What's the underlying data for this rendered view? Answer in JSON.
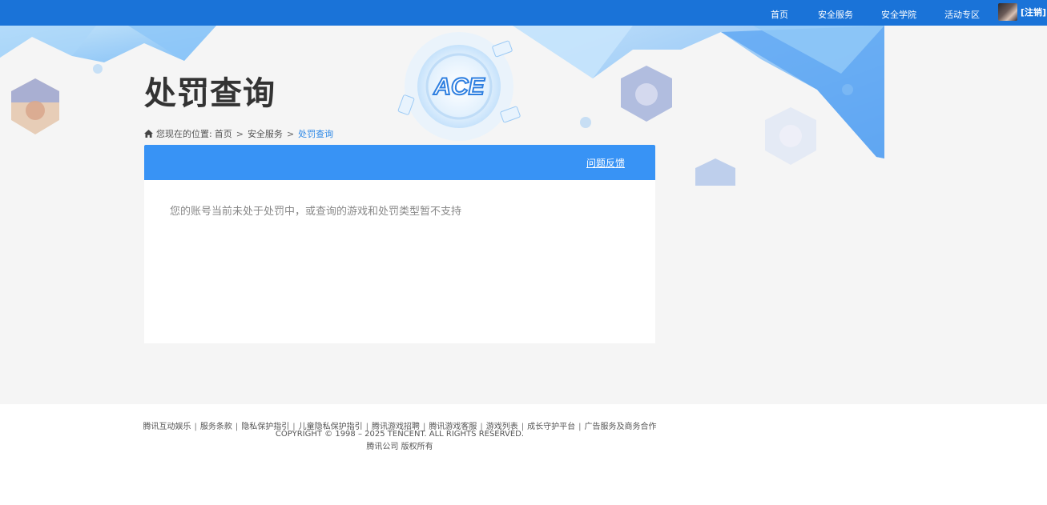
{
  "nav": {
    "items": [
      {
        "label": "首页"
      },
      {
        "label": "安全服务"
      },
      {
        "label": "安全学院"
      },
      {
        "label": "活动专区"
      }
    ],
    "logout_label": "[注销]"
  },
  "banner": {
    "logo_text": "ACE"
  },
  "page": {
    "title": "处罚查询"
  },
  "breadcrumb": {
    "prefix": "您现在的位置:",
    "items": [
      "首页",
      "安全服务"
    ],
    "separator": ">",
    "current": "处罚查询"
  },
  "panel": {
    "feedback_label": "问题反馈",
    "message": "您的账号当前未处于处罚中，或查询的游戏和处罚类型暂不支持"
  },
  "footer": {
    "links": [
      "腾讯互动娱乐",
      "服务条款",
      "隐私保护指引",
      "儿童隐私保护指引",
      "腾讯游戏招聘",
      "腾讯游戏客服",
      "游戏列表",
      "成长守护平台",
      "广告服务及商务合作"
    ],
    "link_separator": "|",
    "copyright": "COPYRIGHT © 1998 – 2025 TENCENT. ALL RIGHTS RESERVED.",
    "company": "腾讯公司 版权所有"
  },
  "colors": {
    "topbar": "#1a73d8",
    "panel_header": "#3893f5",
    "breadcrumb_current": "#2b87e6",
    "background": "#f5f5f5"
  }
}
